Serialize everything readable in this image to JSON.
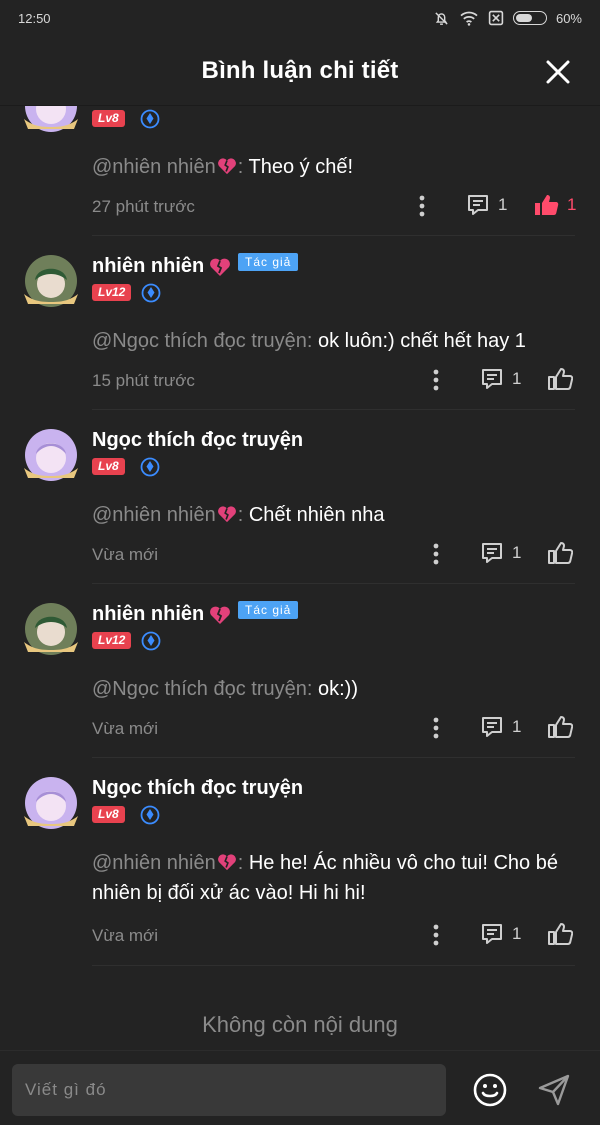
{
  "status_bar": {
    "time": "12:50",
    "battery": "60%",
    "battery_level": 0.6
  },
  "header": {
    "title": "Bình luận chi tiết"
  },
  "comments": [
    {
      "level": "Lv8",
      "mention": "@nhiên nhiên",
      "text": "Theo ý chế!",
      "time": "27 phút trước",
      "replies": "1",
      "likes": "1",
      "liked": true
    },
    {
      "user": "nhiên nhiên",
      "author_tag": "Tác giả",
      "level": "Lv12",
      "mention": "@Ngọc thích đọc truyện:",
      "text": "ok luôn:) chết hết hay 1",
      "time": "15 phút trước",
      "replies": "1",
      "liked": false
    },
    {
      "user": "Ngọc thích đọc truyện",
      "level": "Lv8",
      "mention": "@nhiên nhiên",
      "text": "Chết nhiên nha",
      "time": "Vừa mới",
      "replies": "1",
      "liked": false
    },
    {
      "user": "nhiên nhiên",
      "author_tag": "Tác giả",
      "level": "Lv12",
      "mention": "@Ngọc thích đọc truyện:",
      "text": "ok:))",
      "time": "Vừa mới",
      "replies": "1",
      "liked": false
    },
    {
      "user": "Ngọc thích đọc truyện",
      "level": "Lv8",
      "mention": "@nhiên nhiên",
      "text": "He he! Ác nhiều vô cho tui! Cho bé nhiên bị đối xử ác vào! Hi hi hi!",
      "time": "Vừa mới",
      "replies": "1",
      "liked": false
    }
  ],
  "end_text": "Không còn nội dung",
  "input": {
    "placeholder": "Viết gì đó"
  },
  "colors": {
    "background": "#232323",
    "level_badge": "#e8424f",
    "author_tag": "#4da3f5",
    "like_active": "#ff4b6b",
    "verify_blue": "#3b8cff"
  },
  "icons": [
    "mute-bell-icon",
    "wifi-icon",
    "sim-icon",
    "battery-icon",
    "close-icon",
    "heart-icon",
    "verify-icon",
    "more-icon",
    "reply-icon",
    "like-icon",
    "emoji-icon",
    "send-icon"
  ]
}
